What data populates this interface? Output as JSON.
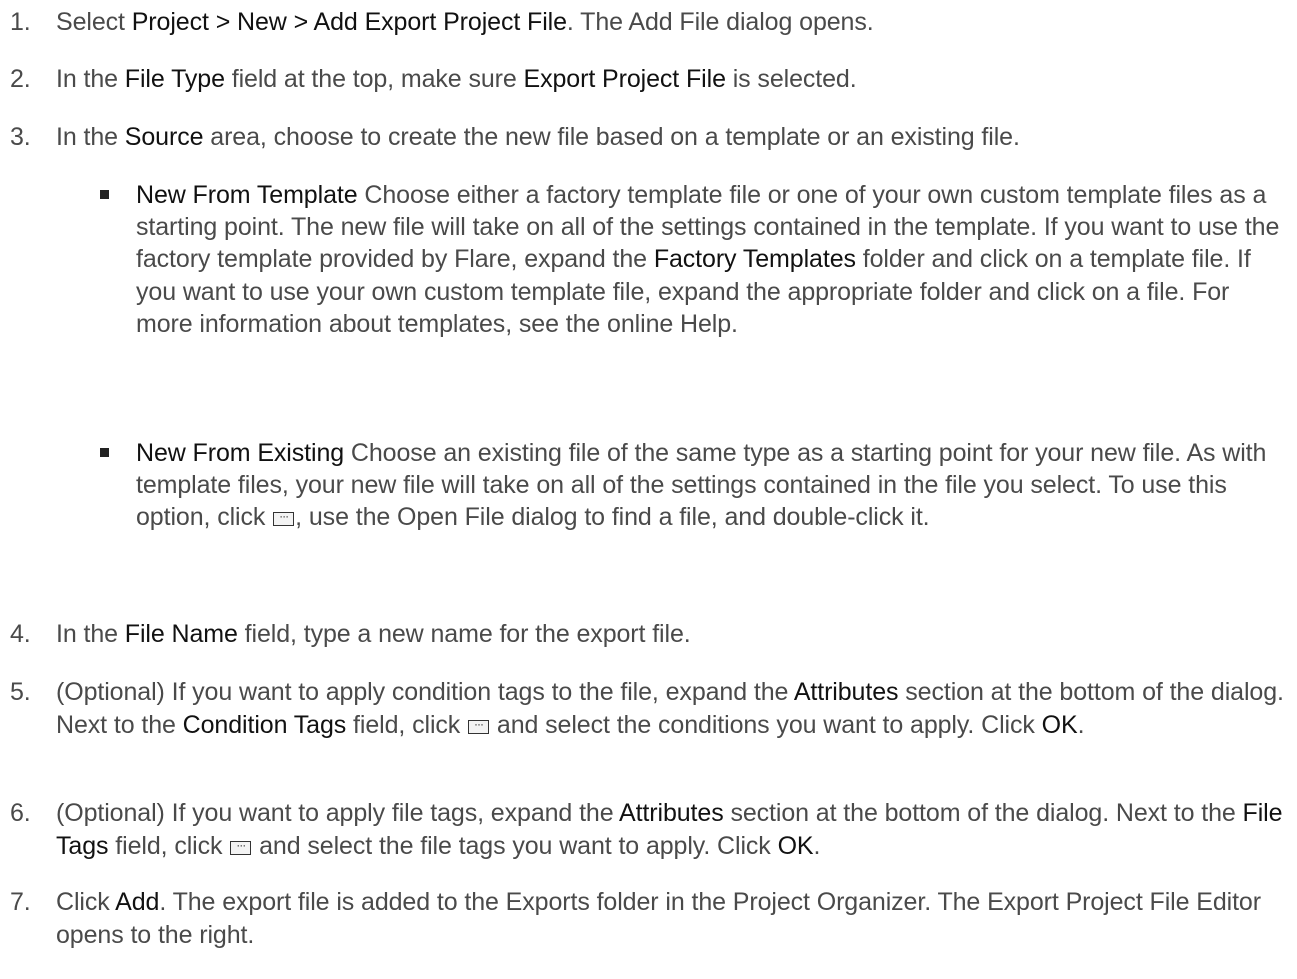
{
  "steps": [
    {
      "num": "1.",
      "parts": [
        "Select ",
        "Project > New > Add Export Project File",
        ". The Add File dialog opens."
      ]
    },
    {
      "num": "2.",
      "parts": [
        "In the ",
        "File Type",
        " field at the top, make sure ",
        "Export Project File",
        " is selected."
      ]
    },
    {
      "num": "3.",
      "parts": [
        "In the ",
        "Source",
        " area, choose to create the new file based on a template or an existing file."
      ]
    },
    {
      "num": "4.",
      "parts": [
        "In the ",
        "File Name",
        " field, type a new name for the export file."
      ]
    },
    {
      "num": "5.",
      "parts": [
        "(Optional) If you want to apply condition tags to the file, expand the ",
        "Attributes",
        " section at the bottom of the dialog. Next to the ",
        "Condition Tags",
        " field, click ",
        " and select the conditions you want to apply. Click ",
        "OK",
        "."
      ]
    },
    {
      "num": "6.",
      "parts": [
        "(Optional) If you want to apply file tags, expand the ",
        "Attributes",
        " section at the bottom of the dialog. Next to the ",
        "File Tags",
        " field, click ",
        " and select the file tags you want to apply. Click ",
        "OK",
        "."
      ]
    },
    {
      "num": "7.",
      "parts": [
        "Click ",
        "Add",
        ". The export file is added to the Exports folder in the Project Organizer. The Export Project File Editor opens to the right."
      ]
    }
  ],
  "source_options": [
    {
      "parts": [
        "New From Template",
        " Choose either a factory template file or one of your own custom template files as a starting point. The new file will take on all of the settings contained in the template. If you want to use the factory template provided by Flare, expand the ",
        "Factory Templates",
        " folder and click on a template file. If you want to use your own custom template file, expand the appropriate folder and click on a file. For more information about templates, see the online Help."
      ]
    },
    {
      "parts": [
        "New From Existing",
        " Choose an existing file of the same type as a starting point for your new file. As with template files, your new file will take on all of the settings contained in the file you select. To use this option, click ",
        ", use the Open File dialog to find a file, and double-click it."
      ]
    }
  ],
  "icons": {
    "browse": "browse-ellipsis-icon",
    "bullet": "square-bullet-icon"
  }
}
